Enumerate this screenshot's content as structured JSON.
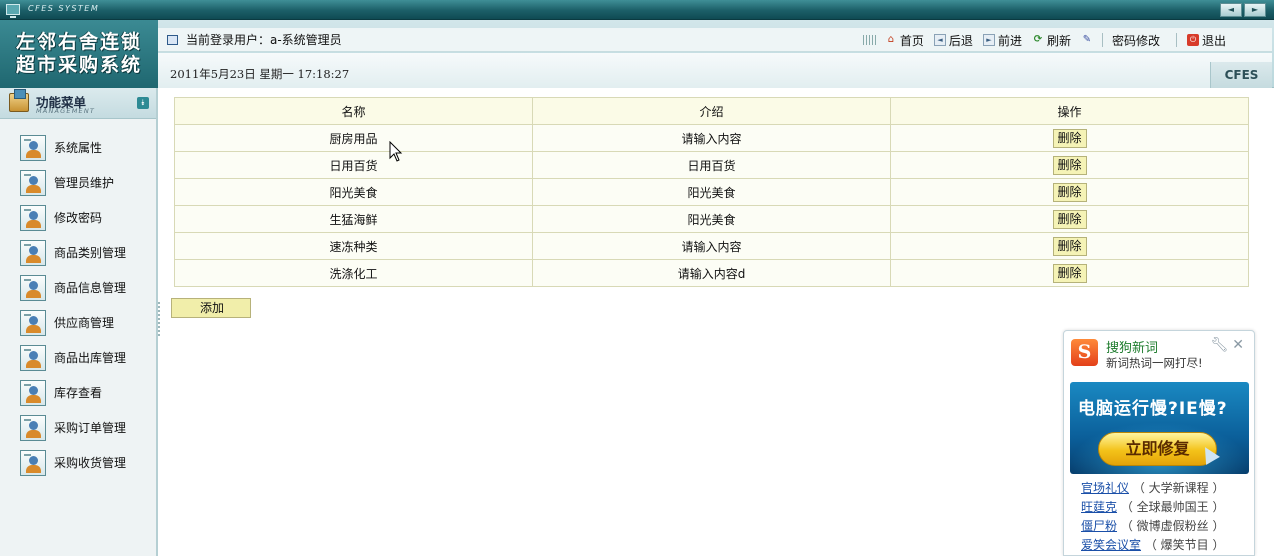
{
  "window": {
    "title": "CFES SYSTEM",
    "prev_label": "◄",
    "next_label": "►"
  },
  "logo": {
    "line1": "左邻右舍连锁",
    "line2": "超市采购系统"
  },
  "header": {
    "user_text": "当前登录用户：a-系统管理员",
    "date_text": "2011年5月23日  星期一  17:18:27",
    "brand": "CFES",
    "toolbar": {
      "home": "首页",
      "back": "后退",
      "forward": "前进",
      "refresh": "刷新",
      "change_password": "密码修改",
      "logout": "退出"
    }
  },
  "sidebar": {
    "title": "功能菜单",
    "subtitle": "MANAGEMENT",
    "collapse_icon": "chevron-down-icon",
    "items": [
      {
        "label": "系统属性"
      },
      {
        "label": "管理员维护"
      },
      {
        "label": "修改密码"
      },
      {
        "label": "商品类别管理"
      },
      {
        "label": "商品信息管理"
      },
      {
        "label": "供应商管理"
      },
      {
        "label": "商品出库管理"
      },
      {
        "label": "库存查看"
      },
      {
        "label": "采购订单管理"
      },
      {
        "label": "采购收货管理"
      }
    ]
  },
  "table": {
    "headers": {
      "name": "名称",
      "intro": "介绍",
      "action": "操作"
    },
    "rows": [
      {
        "name": "厨房用品",
        "intro": "请输入内容",
        "action": "删除"
      },
      {
        "name": "日用百货",
        "intro": "日用百货",
        "action": "删除"
      },
      {
        "name": "阳光美食",
        "intro": "阳光美食",
        "action": "删除"
      },
      {
        "name": "生猛海鲜",
        "intro": "阳光美食",
        "action": "删除"
      },
      {
        "name": "速冻种类",
        "intro": "请输入内容",
        "action": "删除"
      },
      {
        "name": "洗涤化工",
        "intro": "请输入内容d",
        "action": "删除"
      }
    ]
  },
  "add_button": "添加",
  "popup": {
    "logo_letter": "S",
    "title": "搜狗新词",
    "subtitle": "新词热词一网打尽!",
    "banner_text": "电脑运行慢?IE慢?",
    "banner_button": "立即修复",
    "hot_words": [
      {
        "word": "官场礼仪",
        "note": "（ 大学新课程 ）"
      },
      {
        "word": "旺莛克",
        "note": "（ 全球最帅国王 ）"
      },
      {
        "word": "僵尸粉",
        "note": "（ 微博虚假粉丝 ）"
      },
      {
        "word": "爱笑会议室",
        "note": "（ 爆笑节目 ）"
      }
    ]
  },
  "colors": {
    "titlebar": "#1c5f68",
    "header_bg": "#d2e6ea",
    "table_border": "#d8d9b6",
    "button_bg": "#f1eeaa",
    "popup_green": "#1e7c2d"
  }
}
